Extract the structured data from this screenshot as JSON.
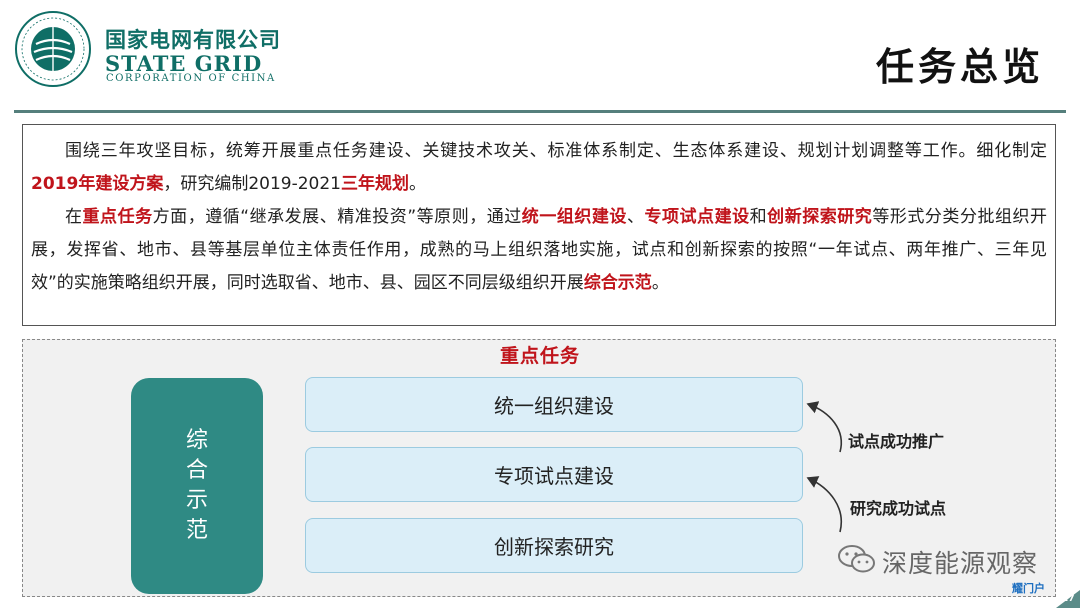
{
  "header": {
    "company_cn": "国家电网有限公司",
    "company_en_line1": "STATE GRID",
    "company_en_line2": "CORPORATION OF CHINA",
    "page_title": "任务总览"
  },
  "summary": {
    "p1_a": "围绕三年攻坚目标，统筹开展重点任务建设、关键技术攻关、标准体系制定、生态体系建设、规划计划调整等工作。细化制定",
    "p1_h1": "2019年建设方案",
    "p1_b": "，研究编制2019-2021",
    "p1_h2": "三年规划",
    "p1_c": "。",
    "p2_a": "在",
    "p2_h1": "重点任务",
    "p2_b": "方面，遵循“继承发展、精准投资”等原则，通过",
    "p2_h2": "统一组织建设",
    "p2_c": "、",
    "p2_h3": "专项试点建设",
    "p2_d": "和",
    "p2_h4": "创新探索研究",
    "p2_e": "等形式分类分批组织开展，发挥省、地市、县等基层单位主体责任作用，成熟的马上组织落地实施，试点和创新探索的按照“一年试点、两年推广、三年见效”的实施策略组织开展，同时选取省、地市、县、园区不同层级组织开展",
    "p2_h5": "综合示范",
    "p2_f": "。"
  },
  "diagram": {
    "title": "重点任务",
    "demo_chars": [
      "综",
      "合",
      "示",
      "范"
    ],
    "tasks": [
      "统一组织建设",
      "专项试点建设",
      "创新探索研究"
    ],
    "arrow_labels": [
      "试点成功推广",
      "研究成功试点"
    ]
  },
  "watermark": {
    "text": "深度能源观察",
    "badge": "耀门户",
    "page_number": "27"
  },
  "colors": {
    "brand_green": "#0f6e66",
    "highlight_red": "#c0141b",
    "demo_box": "#2f8a84",
    "task_fill": "#dbeef8"
  }
}
